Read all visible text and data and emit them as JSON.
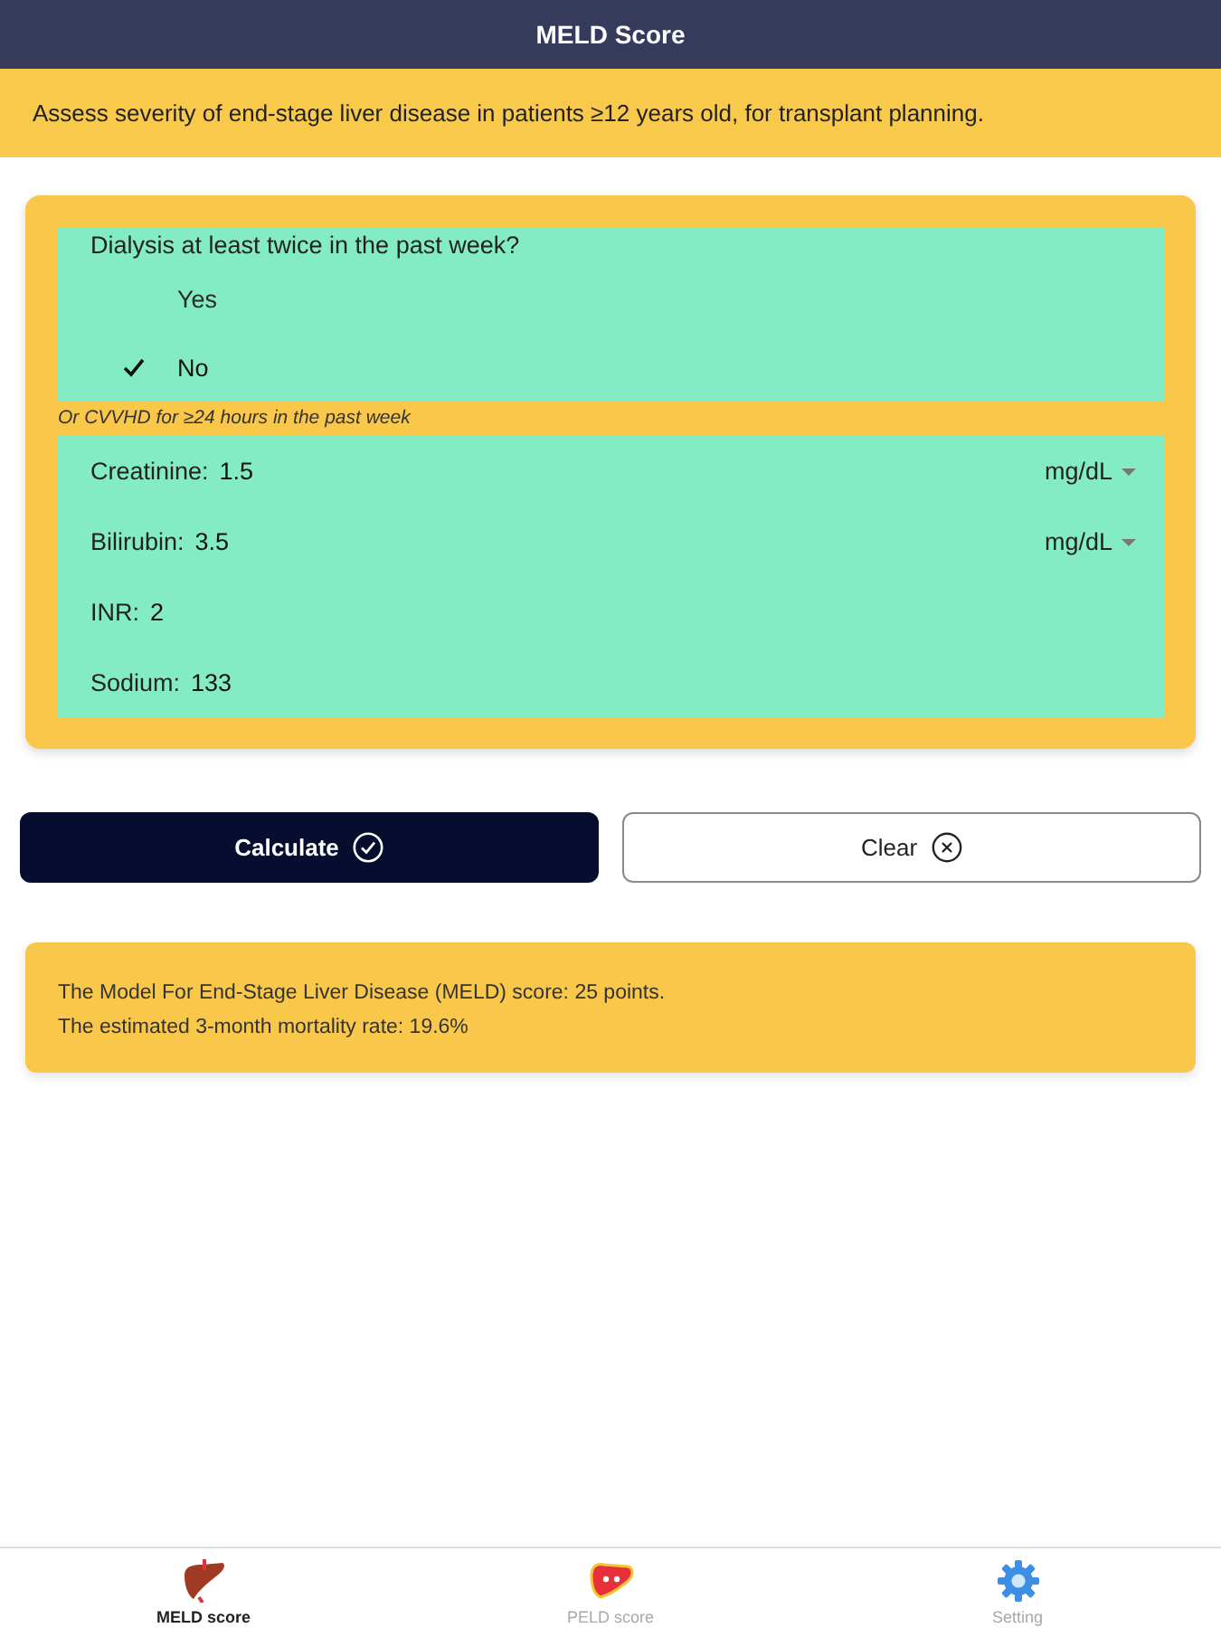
{
  "header": {
    "title": "MELD Score"
  },
  "banner": {
    "text": "Assess severity of end-stage liver disease in patients ≥12 years old, for transplant planning."
  },
  "form": {
    "dialysis": {
      "question": "Dialysis at least twice in the past week?",
      "options": [
        {
          "label": "Yes",
          "selected": false
        },
        {
          "label": "No",
          "selected": true
        }
      ]
    },
    "note": "Or CVVHD for ≥24 hours in the past week",
    "fields": [
      {
        "label": "Creatinine:",
        "value": "1.5",
        "unit": "mg/dL"
      },
      {
        "label": "Bilirubin:",
        "value": "3.5",
        "unit": "mg/dL"
      },
      {
        "label": "INR:",
        "value": "2"
      },
      {
        "label": "Sodium:",
        "value": "133"
      }
    ]
  },
  "buttons": [
    {
      "label": "Calculate",
      "kind": "primary"
    },
    {
      "label": "Clear",
      "kind": "secondary"
    }
  ],
  "result": {
    "lines": [
      "The Model For End-Stage Liver Disease (MELD) score: 25 points.",
      "The estimated 3-month mortality rate: 19.6%"
    ]
  },
  "tab_bar": {
    "tabs": [
      {
        "label": "MELD score",
        "kind": "meld",
        "selected": true
      },
      {
        "label": "PELD score",
        "kind": "peld",
        "selected": false
      },
      {
        "label": "Setting",
        "kind": "settings",
        "selected": false
      }
    ]
  }
}
